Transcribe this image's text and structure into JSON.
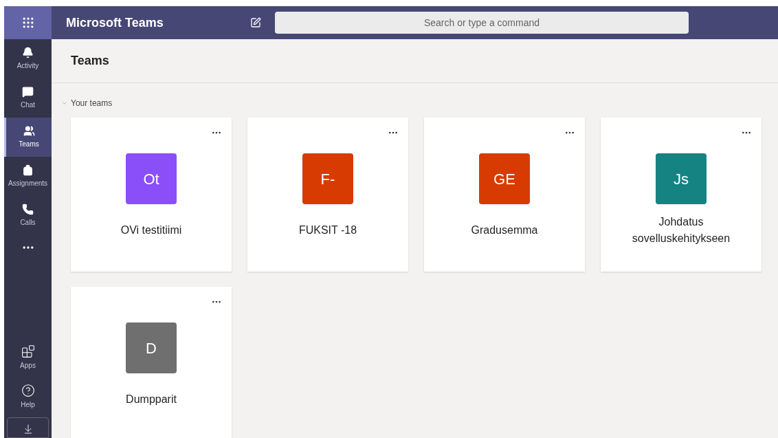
{
  "app_title": "Microsoft Teams",
  "search": {
    "placeholder": "Search or type a command"
  },
  "rail": [
    {
      "label": "Activity",
      "selected": false
    },
    {
      "label": "Chat",
      "selected": false
    },
    {
      "label": "Teams",
      "selected": true
    },
    {
      "label": "Assignments",
      "selected": false
    },
    {
      "label": "Calls",
      "selected": false
    }
  ],
  "rail_bottom": [
    {
      "label": "Apps"
    },
    {
      "label": "Help"
    }
  ],
  "page_title": "Teams",
  "section": {
    "label": "Your teams",
    "expanded": true
  },
  "teams": [
    {
      "initials": "Ot",
      "name": "OVi testitiimi",
      "color": "#8a4ff8"
    },
    {
      "initials": "F-",
      "name": "FUKSIT -18",
      "color": "#d83b01"
    },
    {
      "initials": "GE",
      "name": "Gradusemma",
      "color": "#d83b01"
    },
    {
      "initials": "Js",
      "name": "Johdatus sovelluskehitykseen",
      "color": "#168383"
    },
    {
      "initials": "D",
      "name": "Dumpparit",
      "color": "#6f6f6f"
    }
  ]
}
